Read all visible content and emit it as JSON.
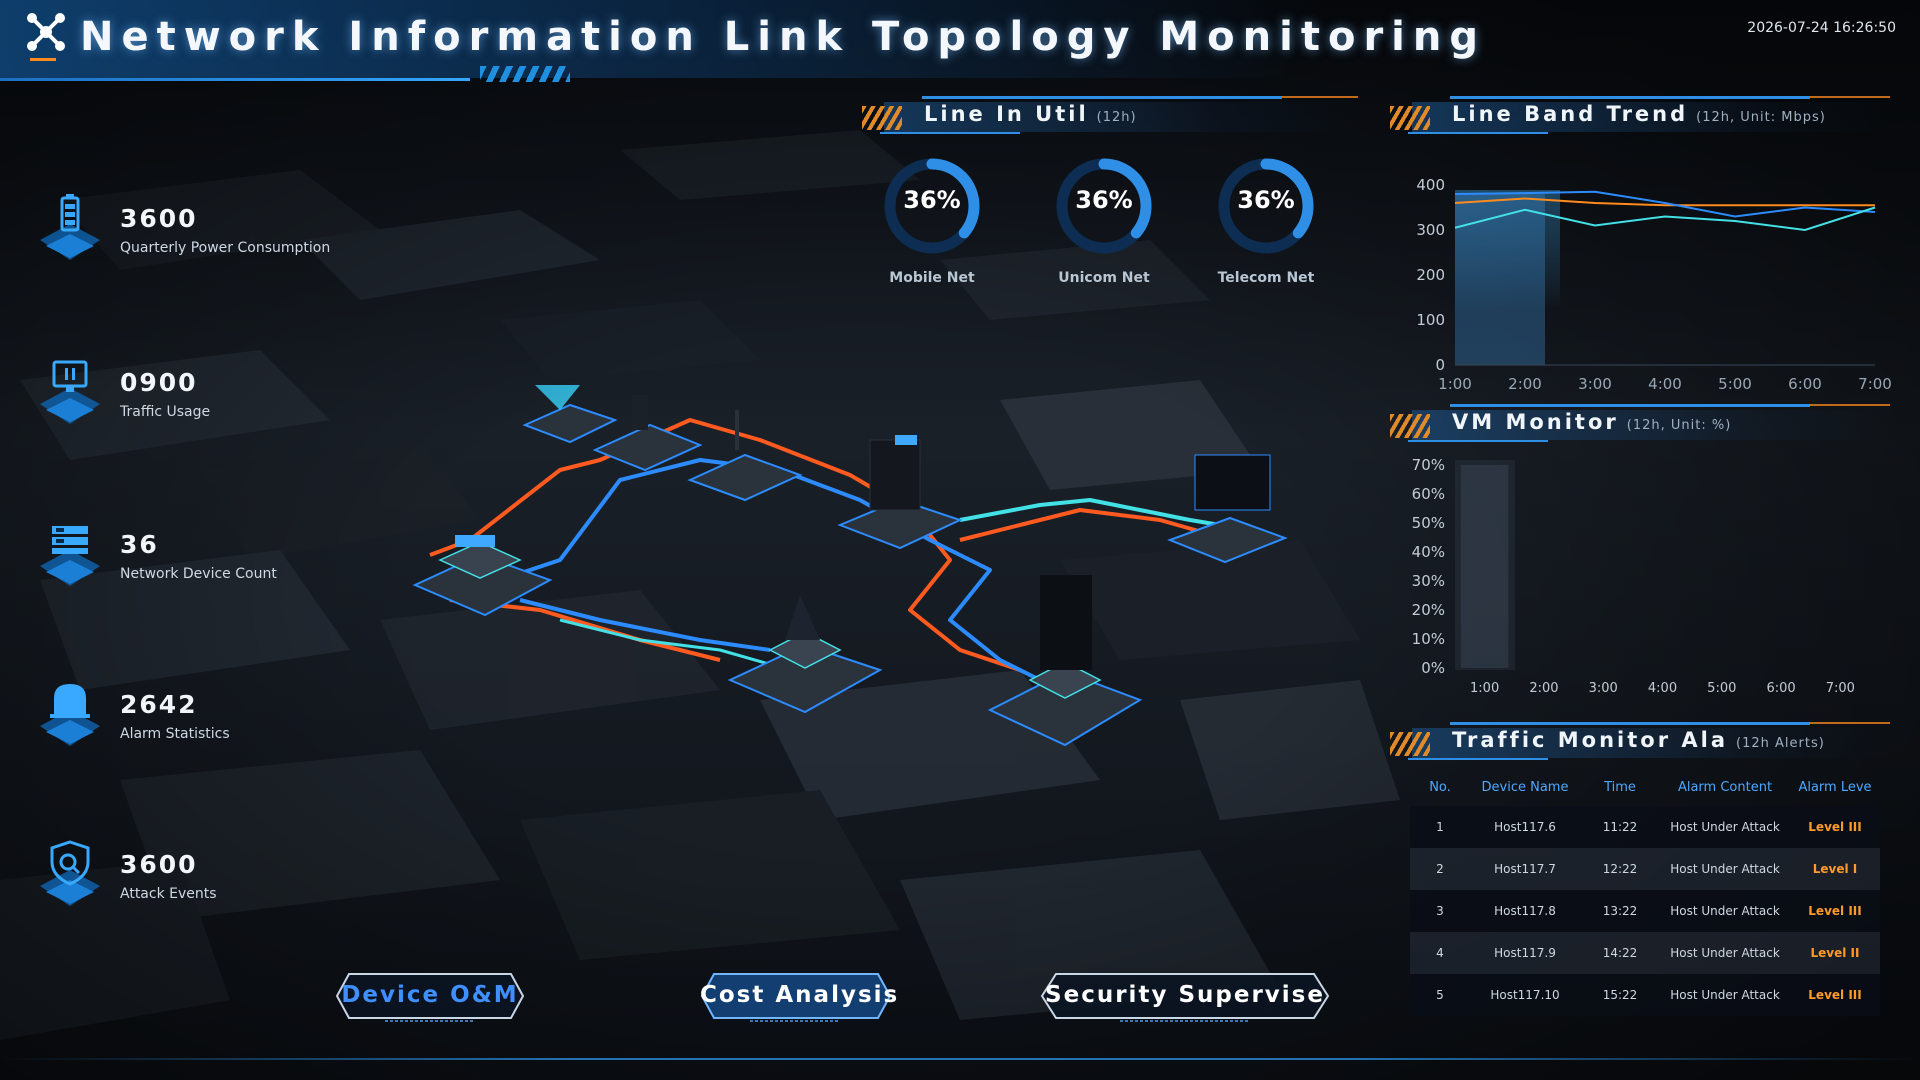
{
  "header": {
    "title": "Network Information Link Topology Monitoring",
    "datetime": "2026-07-24 16:26:50"
  },
  "colors": {
    "accent_blue": "#2f8fe6",
    "accent_orange": "#ff9a2a",
    "link_orange": "#ff5a1f",
    "link_blue": "#2c8cff",
    "link_cyan": "#43e0e6"
  },
  "stats": [
    {
      "value": "3600",
      "label": "Quarterly Power Consumption",
      "icon": "battery-icon"
    },
    {
      "value": "0900",
      "label": "Traffic Usage",
      "icon": "monitor-icon"
    },
    {
      "value": "36",
      "label": "Network Device Count",
      "icon": "server-rack-icon"
    },
    {
      "value": "2642",
      "label": "Alarm Statistics",
      "icon": "alarm-bell-icon"
    },
    {
      "value": "3600",
      "label": "Attack Events",
      "icon": "shield-search-icon"
    }
  ],
  "panels": {
    "line_util": {
      "title": "Line In Util",
      "subtitle": "(12h)"
    },
    "band_trend": {
      "title": "Line Band Trend",
      "subtitle": "(12h, Unit: Mbps)"
    },
    "vm_monitor": {
      "title": "VM Monitor",
      "subtitle": "(12h, Unit: %)"
    },
    "traffic_alarm": {
      "title": "Traffic Monitor Ala",
      "subtitle": "(12h Alerts)"
    }
  },
  "gauges": [
    {
      "label": "Mobile Net",
      "value": "36%",
      "fraction": 0.36
    },
    {
      "label": "Unicom Net",
      "value": "36%",
      "fraction": 0.36
    },
    {
      "label": "Telecom Net",
      "value": "36%",
      "fraction": 0.36
    }
  ],
  "chart_data": [
    {
      "type": "line",
      "title": "Line Band Trend",
      "x": [
        "1:00",
        "2:00",
        "3:00",
        "4:00",
        "5:00",
        "6:00",
        "7:00"
      ],
      "yticks": [
        "0",
        "100",
        "200",
        "300",
        "400"
      ],
      "ylim": [
        0,
        400
      ],
      "series": [
        {
          "color": "#ff8a1e",
          "values": [
            360,
            370,
            360,
            355,
            355,
            355,
            355
          ]
        },
        {
          "color": "#2c8cff",
          "values": [
            380,
            382,
            385,
            360,
            330,
            350,
            340
          ]
        },
        {
          "color": "#43e0e6",
          "values": [
            305,
            345,
            310,
            330,
            320,
            300,
            350
          ]
        }
      ],
      "highlight_category": "2:00",
      "grid": false
    },
    {
      "type": "bar",
      "title": "VM Monitor",
      "categories": [
        "1:00",
        "2:00",
        "3:00",
        "4:00",
        "5:00",
        "6:00",
        "7:00"
      ],
      "yticks": [
        "0%",
        "10%",
        "20%",
        "30%",
        "40%",
        "50%",
        "60%",
        "70%"
      ],
      "ylim": [
        0,
        70
      ],
      "highlight_category": "1:00",
      "grid": false
    }
  ],
  "alarm_table": {
    "columns": [
      "No.",
      "Device Name",
      "Time",
      "Alarm Content",
      "Alarm Leve"
    ],
    "rows": [
      [
        "1",
        "Host117.6",
        "11:22",
        "Host Under Attack",
        "Level III"
      ],
      [
        "2",
        "Host117.7",
        "12:22",
        "Host Under Attack",
        "Level I"
      ],
      [
        "3",
        "Host117.8",
        "13:22",
        "Host Under Attack",
        "Level III"
      ],
      [
        "4",
        "Host117.9",
        "14:22",
        "Host Under Attack",
        "Level II"
      ],
      [
        "5",
        "Host117.10",
        "15:22",
        "Host Under Attack",
        "Level III"
      ]
    ]
  },
  "nav": [
    {
      "label": "Device O&M",
      "active": true
    },
    {
      "label": "Cost Analysis",
      "active": false
    },
    {
      "label": "Security Supervise",
      "active": false
    }
  ]
}
